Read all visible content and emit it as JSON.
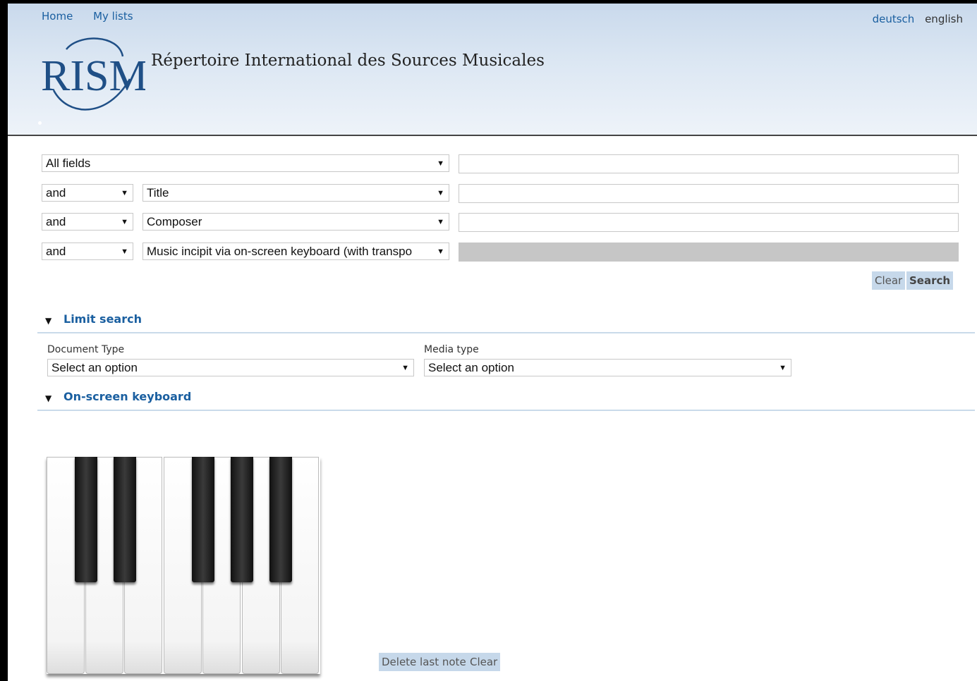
{
  "nav": {
    "home": "Home",
    "my_lists": "My lists"
  },
  "languages": {
    "de": "deutsch",
    "en": "english"
  },
  "logo_text": "RISM",
  "site_title": "Répertoire International des Sources Musicales",
  "search": {
    "rows": [
      {
        "field": "All fields",
        "value": ""
      },
      {
        "operator": "and",
        "field": "Title",
        "value": ""
      },
      {
        "operator": "and",
        "field": "Composer",
        "value": ""
      },
      {
        "operator": "and",
        "field": "Music incipit via on-screen keyboard (with transpo",
        "value": ""
      }
    ],
    "clear_label": "Clear",
    "search_label": "Search"
  },
  "limit_search": {
    "title": "Limit search",
    "document_type_label": "Document Type",
    "document_type_value": "Select an option",
    "media_type_label": "Media type",
    "media_type_value": "Select an option"
  },
  "keyboard": {
    "title": "On-screen keyboard",
    "white_keys": [
      "C",
      "D",
      "E",
      "F",
      "G",
      "A",
      "B"
    ],
    "black_keys": [
      "C#",
      "D#",
      "F#",
      "G#",
      "A#"
    ],
    "delete_label": "Delete last note",
    "clear_label": "Clear"
  },
  "colors": {
    "link": "#1a5fa0",
    "button_bg": "#c6d8ea",
    "header_bg": "#d4e2f1"
  }
}
